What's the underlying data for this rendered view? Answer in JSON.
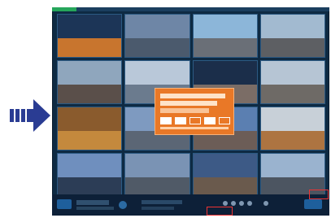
{
  "arrow_color": "#2a3c93",
  "monitor": {
    "title_bar_color": "#1a3e5e",
    "accent_green": "#26a65b",
    "tiles": [
      {
        "sky": "#1c3557",
        "ground": "#c8752e"
      },
      {
        "sky": "#6e86a6",
        "ground": "#4b5a6d"
      },
      {
        "sky": "#8cb6d9",
        "ground": "#6a6f77"
      },
      {
        "sky": "#a2bad0",
        "ground": "#5d5f63"
      },
      {
        "sky": "#8fa6bd",
        "ground": "#5a4f4a"
      },
      {
        "sky": "#b9c8d9",
        "ground": "#6b7b8e"
      },
      {
        "sky": "#1b2e4a",
        "ground": "#7b6d66"
      },
      {
        "sky": "#b6c5d4",
        "ground": "#6e6a66"
      },
      {
        "sky": "#8a5b2d",
        "ground": "#c4893d"
      },
      {
        "sky": "#7e9ac0",
        "ground": "#5b6675"
      },
      {
        "sky": "#5b7fb1",
        "ground": "#6c5d57"
      },
      {
        "sky": "#c8d0d8",
        "ground": "#ad7441"
      },
      {
        "sky": "#6f8fbe",
        "ground": "#2c3d56"
      },
      {
        "sky": "#7a93b4",
        "ground": "#505a67"
      },
      {
        "sky": "#3d5a86",
        "ground": "#6a5a4d"
      },
      {
        "sky": "#9ab3cf",
        "ground": "#4c5561"
      }
    ],
    "dialog_color": "#e97827",
    "highlight_color": "#e33333"
  }
}
